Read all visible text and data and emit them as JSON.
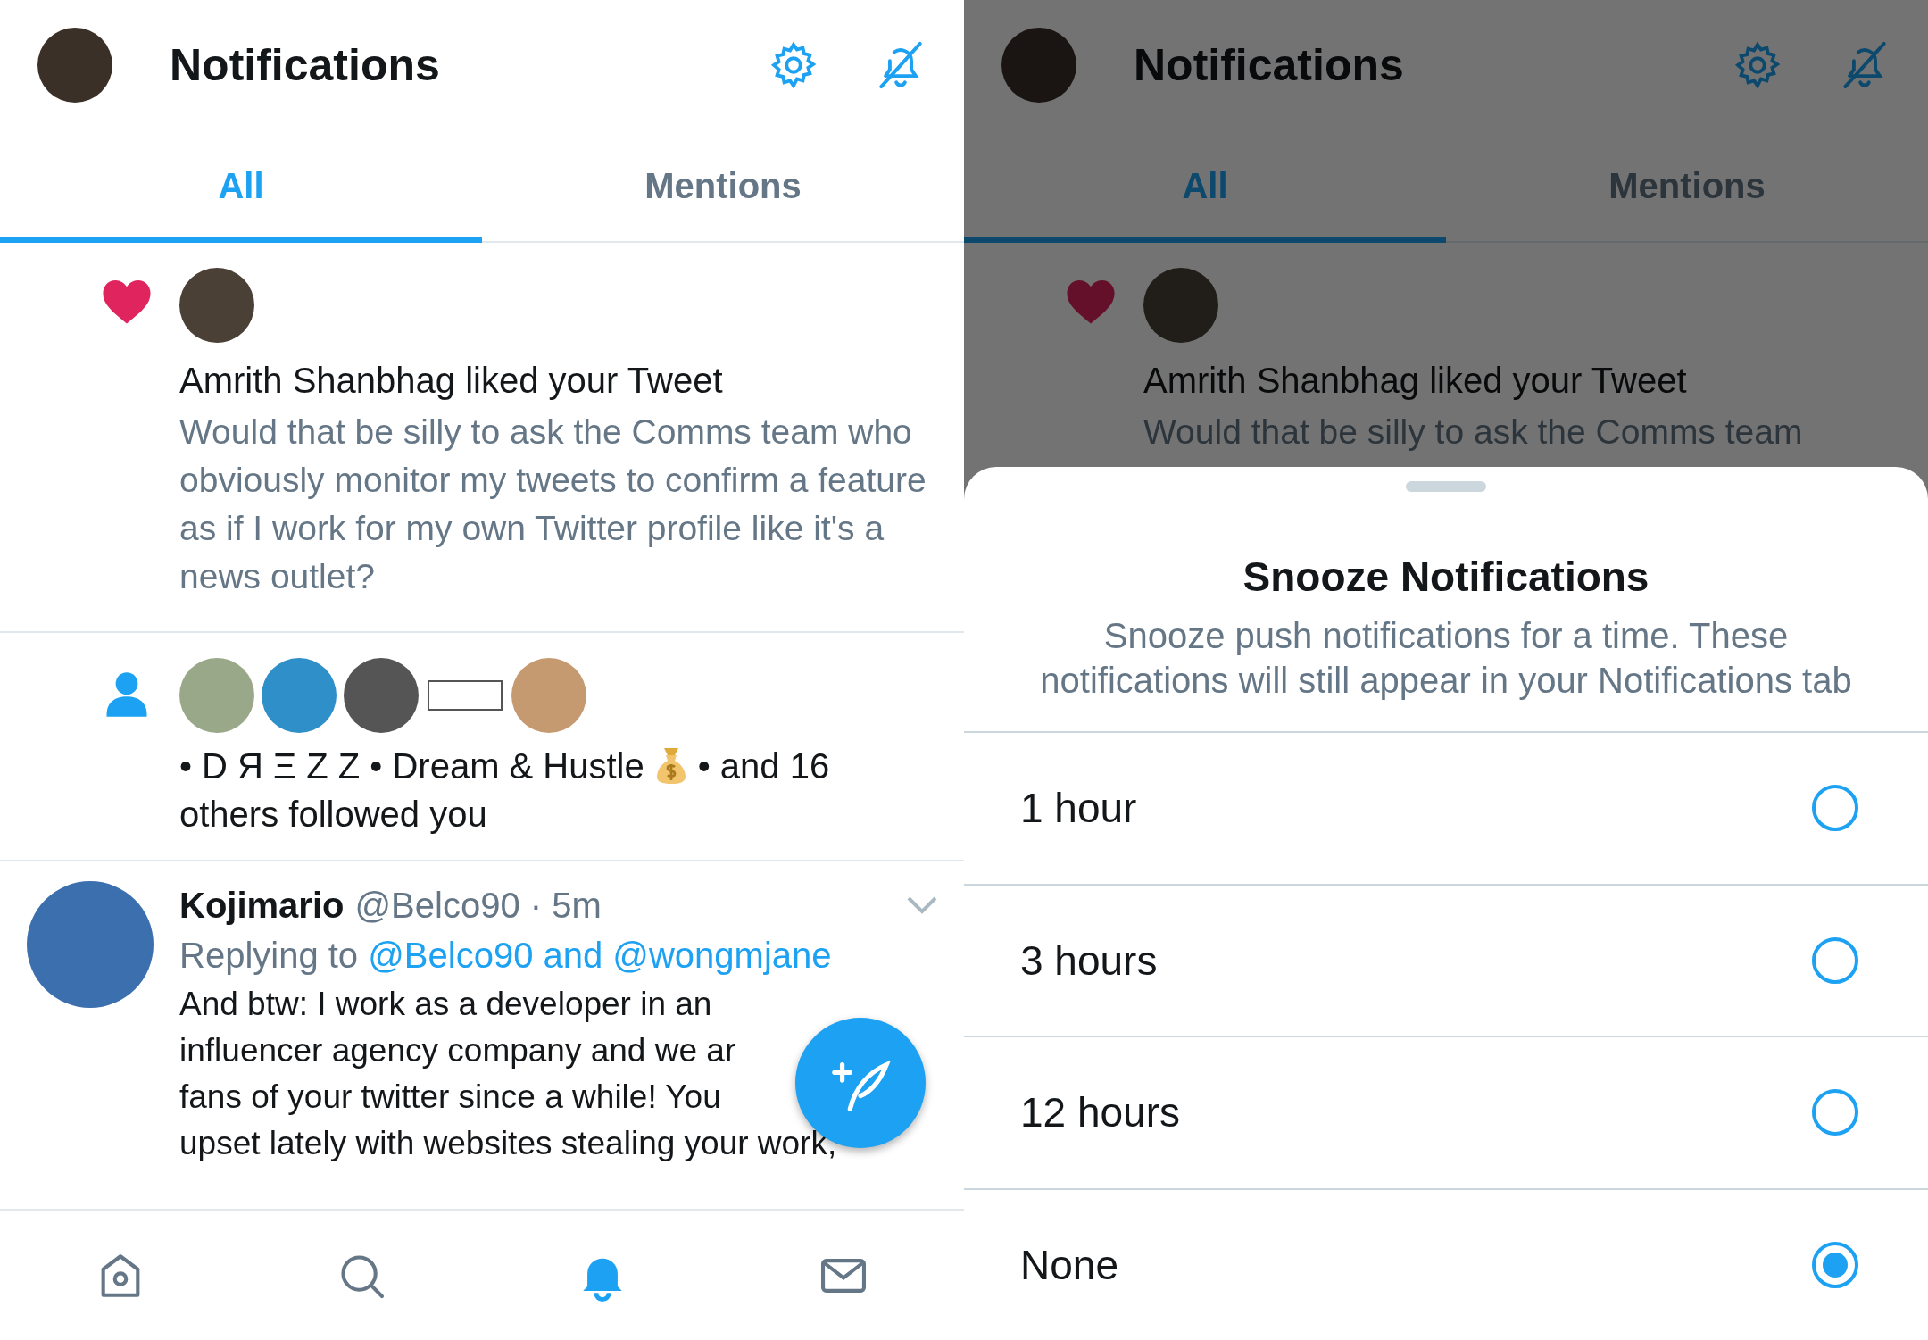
{
  "screens": [
    {
      "header": {
        "title": "Notifications"
      },
      "tabs": [
        {
          "label": "All",
          "selected": true
        },
        {
          "label": "Mentions",
          "selected": false
        }
      ],
      "notifications": [
        {
          "kind": "like",
          "title": "Amrith Shanbhag liked your Tweet",
          "text": "Would that be silly to ask the Comms team who obviously monitor my tweets to confirm a feature as if I work for my own Twitter profile like it's a news outlet?"
        },
        {
          "kind": "follow",
          "text_before": "• D Я Ξ Z Z • Dream & Hustle",
          "text_after": "• and 16",
          "text_continued": "others followed you"
        },
        {
          "kind": "tweet",
          "name": "Kojimario",
          "handle": "@Belco90 · 5m",
          "reply_label": "Replying to",
          "reply_link": "@Belco90 and @wongmjane",
          "body_lines": [
            "And btw: I work as a developer in an",
            "influencer agency company and we ar",
            "fans of your twitter since a while! You",
            "upset lately with websites stealing your work,"
          ]
        }
      ],
      "compose_button": true,
      "bottom_nav": [
        {
          "kind": "home",
          "selected": false
        },
        {
          "kind": "search",
          "selected": false
        },
        {
          "kind": "notifications",
          "selected": true
        },
        {
          "kind": "messages",
          "selected": false
        }
      ]
    },
    {
      "header": {
        "title": "Notifications"
      },
      "tabs": [
        {
          "label": "All",
          "selected": true
        },
        {
          "label": "Mentions",
          "selected": false
        }
      ],
      "notifications": [
        {
          "kind": "like",
          "title": "Amrith Shanbhag liked your Tweet",
          "text": "Would that be silly to ask the Comms team"
        }
      ],
      "snooze_sheet": {
        "title": "Snooze Notifications",
        "description": "Snooze push notifications for a time. These notifications will still appear in your Notifications tab",
        "options": [
          {
            "label": "1 hour",
            "selected": false
          },
          {
            "label": "3 hours",
            "selected": false
          },
          {
            "label": "12 hours",
            "selected": false
          },
          {
            "label": "None",
            "selected": true
          }
        ]
      }
    }
  ]
}
